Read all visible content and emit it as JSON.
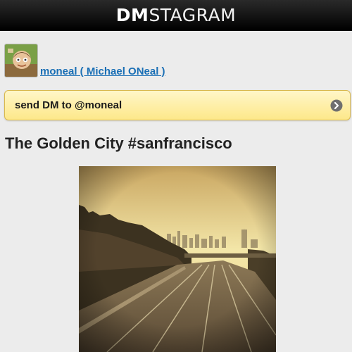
{
  "header": {
    "brand_bold": "DM",
    "brand_light": "STAGRAM"
  },
  "user": {
    "display": "moneal ( Michael ONeal )"
  },
  "dm_button": {
    "label": "send DM to @moneal",
    "icon": "chevron-right-icon"
  },
  "post": {
    "title": "The Golden City #sanfrancisco"
  },
  "colors": {
    "accent_link": "#1a6fb5",
    "dm_bar": "#fde88a",
    "header_bg": "#000000"
  }
}
